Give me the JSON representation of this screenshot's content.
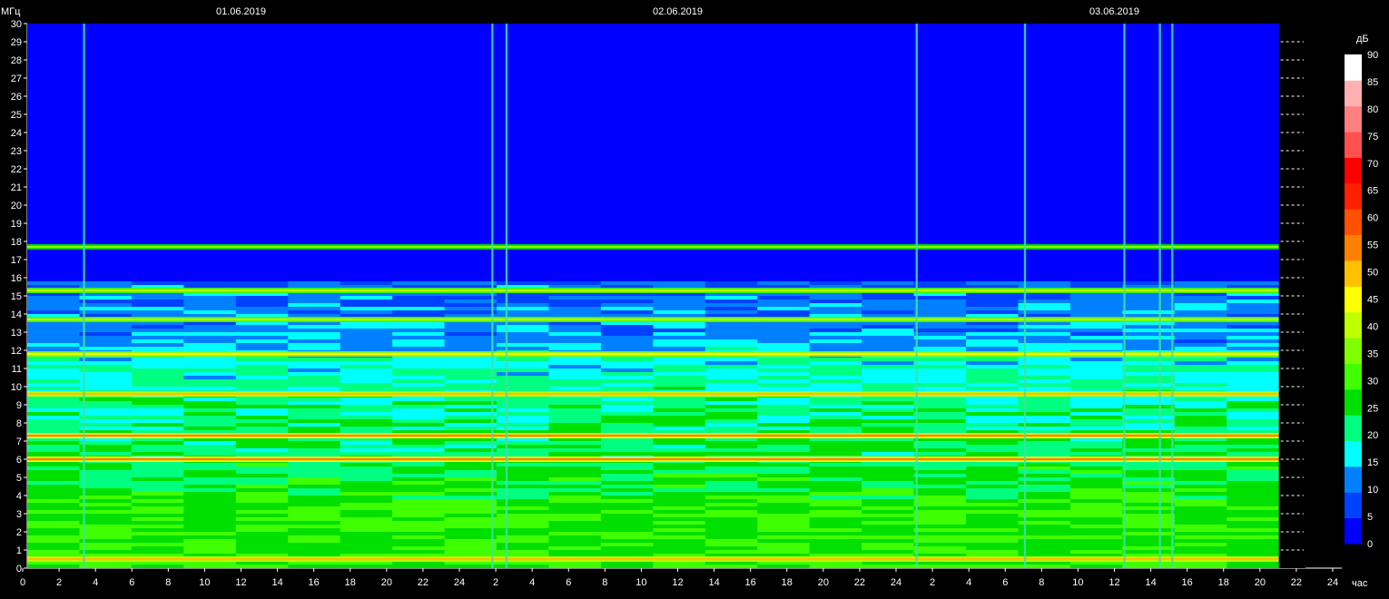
{
  "chart_data": {
    "type": "heatmap",
    "title": "",
    "ylabel": "МГц",
    "xlabel": "час",
    "colorbar_label": "дБ",
    "ylim": [
      0,
      30
    ],
    "xlim_hours": [
      0,
      72
    ],
    "y_ticks": [
      0,
      1,
      2,
      3,
      4,
      5,
      6,
      7,
      8,
      9,
      10,
      11,
      12,
      13,
      14,
      15,
      16,
      17,
      18,
      19,
      20,
      21,
      22,
      23,
      24,
      25,
      26,
      27,
      28,
      29,
      30
    ],
    "x_tick_labels": [
      "0",
      "2",
      "4",
      "6",
      "8",
      "10",
      "12",
      "14",
      "16",
      "18",
      "20",
      "22",
      "24",
      "2",
      "4",
      "6",
      "8",
      "10",
      "12",
      "14",
      "16",
      "18",
      "20",
      "22",
      "24",
      "2",
      "4",
      "6",
      "8",
      "10",
      "12",
      "14",
      "16",
      "18",
      "20",
      "22",
      "24"
    ],
    "dates": [
      {
        "label": "01.06.2019",
        "hour": 12
      },
      {
        "label": "02.06.2019",
        "hour": 36
      },
      {
        "label": "03.06.2019",
        "hour": 60
      }
    ],
    "data_end_hour": 70.5,
    "colorbar": {
      "levels": [
        0,
        5,
        10,
        15,
        20,
        25,
        30,
        35,
        40,
        45,
        50,
        55,
        60,
        65,
        70,
        75,
        80,
        85,
        90
      ],
      "colors": [
        "#0000ff",
        "#0040ff",
        "#0080ff",
        "#00ffff",
        "#00ff80",
        "#00e000",
        "#40ff00",
        "#80ff00",
        "#c0ff00",
        "#ffff00",
        "#ffc000",
        "#ff8000",
        "#ff5000",
        "#ff2000",
        "#ff0000",
        "#ff5050",
        "#ff8080",
        "#ffb0b0",
        "#ffffff"
      ]
    },
    "bands_mhz": [
      {
        "freq": 0.5,
        "level": 50
      },
      {
        "freq": 6.0,
        "level": 55
      },
      {
        "freq": 7.3,
        "level": 55
      },
      {
        "freq": 9.6,
        "level": 50
      },
      {
        "freq": 11.8,
        "level": 45
      },
      {
        "freq": 13.7,
        "level": 40
      },
      {
        "freq": 15.3,
        "level": 40
      },
      {
        "freq": 17.7,
        "level": 35
      }
    ],
    "vertical_events_hours": [
      3.2,
      26.2,
      27.0,
      50.1,
      56.2,
      61.8,
      63.8,
      64.5
    ]
  }
}
